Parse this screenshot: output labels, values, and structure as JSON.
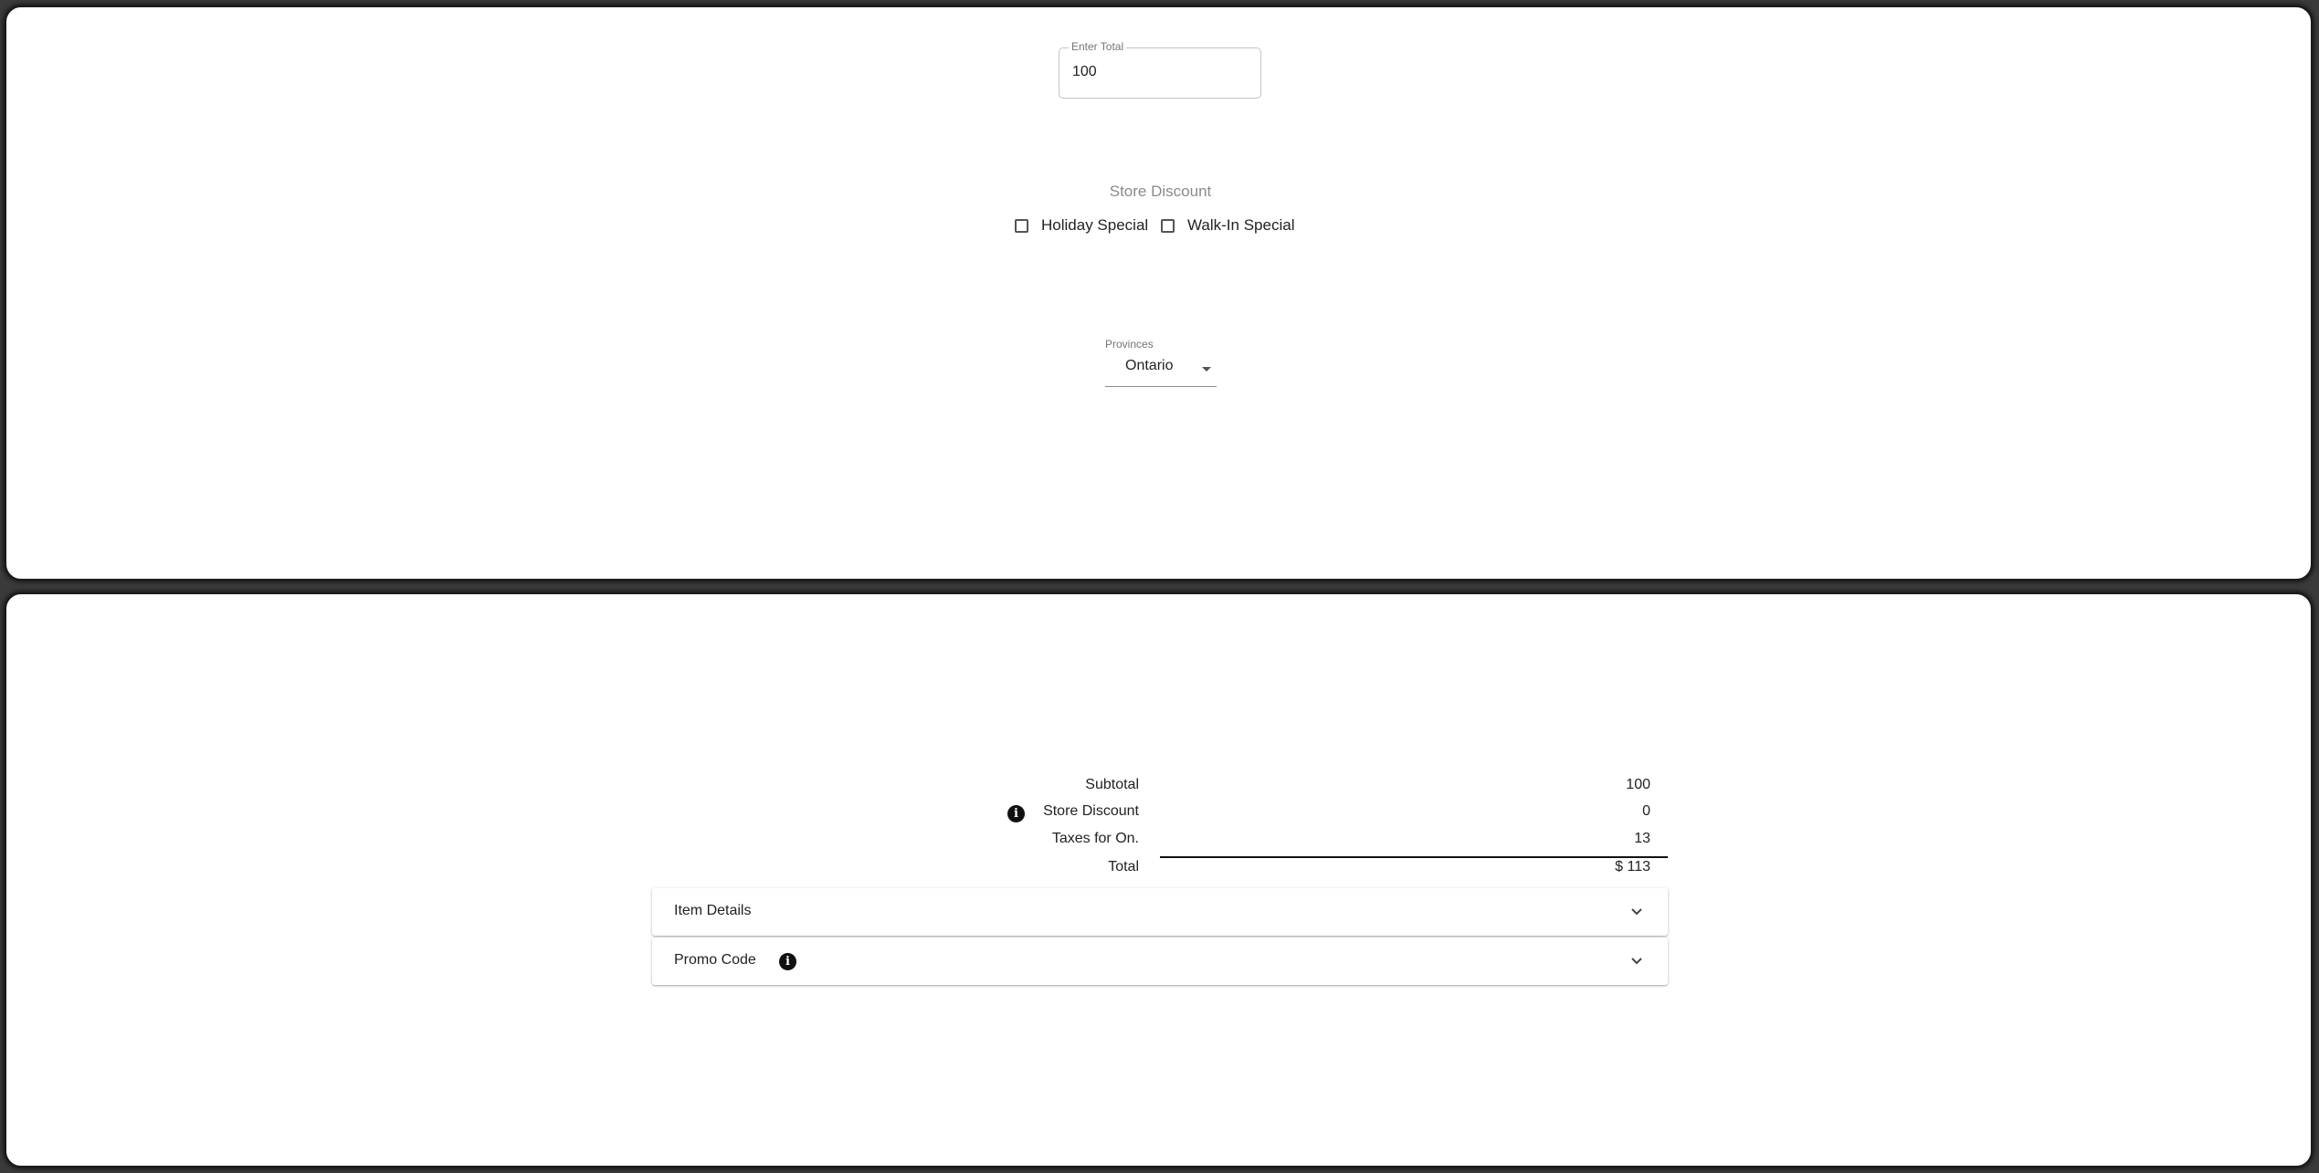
{
  "form": {
    "total_label": "Enter Total",
    "total_value": "100",
    "discount_heading": "Store Discount",
    "checkboxes": [
      {
        "label": "Holiday Special",
        "checked": false
      },
      {
        "label": "Walk-In Special",
        "checked": false
      }
    ],
    "province_label": "Provinces",
    "province_value": "Ontario"
  },
  "summary": {
    "subtotal_label": "Subtotal",
    "subtotal_value": "100",
    "discount_label": "Store Discount",
    "discount_value": "0",
    "taxes_label": "Taxes for On.",
    "taxes_value": "13",
    "total_label": "Total",
    "total_value": "$ 113",
    "info_icon": "info-circle-icon"
  },
  "accordions": [
    {
      "label": "Item Details",
      "icon": "chevron-down-icon"
    },
    {
      "label": "Promo Code",
      "icon": "chevron-down-icon",
      "info_icon": "info-circle-icon"
    }
  ]
}
